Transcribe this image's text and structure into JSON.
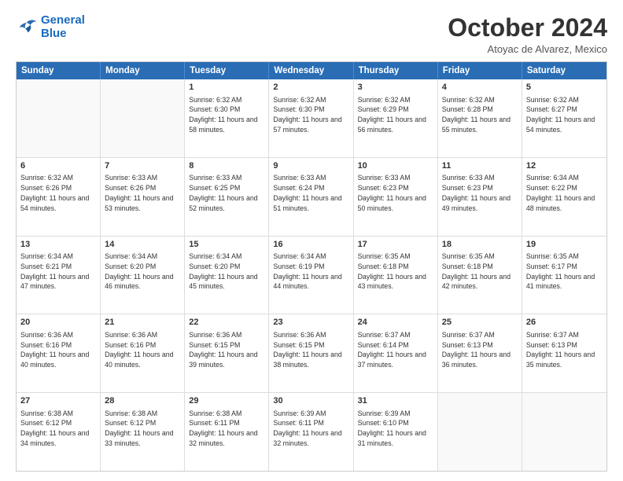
{
  "logo": {
    "line1": "General",
    "line2": "Blue"
  },
  "title": "October 2024",
  "location": "Atoyac de Alvarez, Mexico",
  "header_days": [
    "Sunday",
    "Monday",
    "Tuesday",
    "Wednesday",
    "Thursday",
    "Friday",
    "Saturday"
  ],
  "weeks": [
    [
      {
        "day": "",
        "sunrise": "",
        "sunset": "",
        "daylight": ""
      },
      {
        "day": "",
        "sunrise": "",
        "sunset": "",
        "daylight": ""
      },
      {
        "day": "1",
        "sunrise": "Sunrise: 6:32 AM",
        "sunset": "Sunset: 6:30 PM",
        "daylight": "Daylight: 11 hours and 58 minutes."
      },
      {
        "day": "2",
        "sunrise": "Sunrise: 6:32 AM",
        "sunset": "Sunset: 6:30 PM",
        "daylight": "Daylight: 11 hours and 57 minutes."
      },
      {
        "day": "3",
        "sunrise": "Sunrise: 6:32 AM",
        "sunset": "Sunset: 6:29 PM",
        "daylight": "Daylight: 11 hours and 56 minutes."
      },
      {
        "day": "4",
        "sunrise": "Sunrise: 6:32 AM",
        "sunset": "Sunset: 6:28 PM",
        "daylight": "Daylight: 11 hours and 55 minutes."
      },
      {
        "day": "5",
        "sunrise": "Sunrise: 6:32 AM",
        "sunset": "Sunset: 6:27 PM",
        "daylight": "Daylight: 11 hours and 54 minutes."
      }
    ],
    [
      {
        "day": "6",
        "sunrise": "Sunrise: 6:32 AM",
        "sunset": "Sunset: 6:26 PM",
        "daylight": "Daylight: 11 hours and 54 minutes."
      },
      {
        "day": "7",
        "sunrise": "Sunrise: 6:33 AM",
        "sunset": "Sunset: 6:26 PM",
        "daylight": "Daylight: 11 hours and 53 minutes."
      },
      {
        "day": "8",
        "sunrise": "Sunrise: 6:33 AM",
        "sunset": "Sunset: 6:25 PM",
        "daylight": "Daylight: 11 hours and 52 minutes."
      },
      {
        "day": "9",
        "sunrise": "Sunrise: 6:33 AM",
        "sunset": "Sunset: 6:24 PM",
        "daylight": "Daylight: 11 hours and 51 minutes."
      },
      {
        "day": "10",
        "sunrise": "Sunrise: 6:33 AM",
        "sunset": "Sunset: 6:23 PM",
        "daylight": "Daylight: 11 hours and 50 minutes."
      },
      {
        "day": "11",
        "sunrise": "Sunrise: 6:33 AM",
        "sunset": "Sunset: 6:23 PM",
        "daylight": "Daylight: 11 hours and 49 minutes."
      },
      {
        "day": "12",
        "sunrise": "Sunrise: 6:34 AM",
        "sunset": "Sunset: 6:22 PM",
        "daylight": "Daylight: 11 hours and 48 minutes."
      }
    ],
    [
      {
        "day": "13",
        "sunrise": "Sunrise: 6:34 AM",
        "sunset": "Sunset: 6:21 PM",
        "daylight": "Daylight: 11 hours and 47 minutes."
      },
      {
        "day": "14",
        "sunrise": "Sunrise: 6:34 AM",
        "sunset": "Sunset: 6:20 PM",
        "daylight": "Daylight: 11 hours and 46 minutes."
      },
      {
        "day": "15",
        "sunrise": "Sunrise: 6:34 AM",
        "sunset": "Sunset: 6:20 PM",
        "daylight": "Daylight: 11 hours and 45 minutes."
      },
      {
        "day": "16",
        "sunrise": "Sunrise: 6:34 AM",
        "sunset": "Sunset: 6:19 PM",
        "daylight": "Daylight: 11 hours and 44 minutes."
      },
      {
        "day": "17",
        "sunrise": "Sunrise: 6:35 AM",
        "sunset": "Sunset: 6:18 PM",
        "daylight": "Daylight: 11 hours and 43 minutes."
      },
      {
        "day": "18",
        "sunrise": "Sunrise: 6:35 AM",
        "sunset": "Sunset: 6:18 PM",
        "daylight": "Daylight: 11 hours and 42 minutes."
      },
      {
        "day": "19",
        "sunrise": "Sunrise: 6:35 AM",
        "sunset": "Sunset: 6:17 PM",
        "daylight": "Daylight: 11 hours and 41 minutes."
      }
    ],
    [
      {
        "day": "20",
        "sunrise": "Sunrise: 6:36 AM",
        "sunset": "Sunset: 6:16 PM",
        "daylight": "Daylight: 11 hours and 40 minutes."
      },
      {
        "day": "21",
        "sunrise": "Sunrise: 6:36 AM",
        "sunset": "Sunset: 6:16 PM",
        "daylight": "Daylight: 11 hours and 40 minutes."
      },
      {
        "day": "22",
        "sunrise": "Sunrise: 6:36 AM",
        "sunset": "Sunset: 6:15 PM",
        "daylight": "Daylight: 11 hours and 39 minutes."
      },
      {
        "day": "23",
        "sunrise": "Sunrise: 6:36 AM",
        "sunset": "Sunset: 6:15 PM",
        "daylight": "Daylight: 11 hours and 38 minutes."
      },
      {
        "day": "24",
        "sunrise": "Sunrise: 6:37 AM",
        "sunset": "Sunset: 6:14 PM",
        "daylight": "Daylight: 11 hours and 37 minutes."
      },
      {
        "day": "25",
        "sunrise": "Sunrise: 6:37 AM",
        "sunset": "Sunset: 6:13 PM",
        "daylight": "Daylight: 11 hours and 36 minutes."
      },
      {
        "day": "26",
        "sunrise": "Sunrise: 6:37 AM",
        "sunset": "Sunset: 6:13 PM",
        "daylight": "Daylight: 11 hours and 35 minutes."
      }
    ],
    [
      {
        "day": "27",
        "sunrise": "Sunrise: 6:38 AM",
        "sunset": "Sunset: 6:12 PM",
        "daylight": "Daylight: 11 hours and 34 minutes."
      },
      {
        "day": "28",
        "sunrise": "Sunrise: 6:38 AM",
        "sunset": "Sunset: 6:12 PM",
        "daylight": "Daylight: 11 hours and 33 minutes."
      },
      {
        "day": "29",
        "sunrise": "Sunrise: 6:38 AM",
        "sunset": "Sunset: 6:11 PM",
        "daylight": "Daylight: 11 hours and 32 minutes."
      },
      {
        "day": "30",
        "sunrise": "Sunrise: 6:39 AM",
        "sunset": "Sunset: 6:11 PM",
        "daylight": "Daylight: 11 hours and 32 minutes."
      },
      {
        "day": "31",
        "sunrise": "Sunrise: 6:39 AM",
        "sunset": "Sunset: 6:10 PM",
        "daylight": "Daylight: 11 hours and 31 minutes."
      },
      {
        "day": "",
        "sunrise": "",
        "sunset": "",
        "daylight": ""
      },
      {
        "day": "",
        "sunrise": "",
        "sunset": "",
        "daylight": ""
      }
    ]
  ]
}
